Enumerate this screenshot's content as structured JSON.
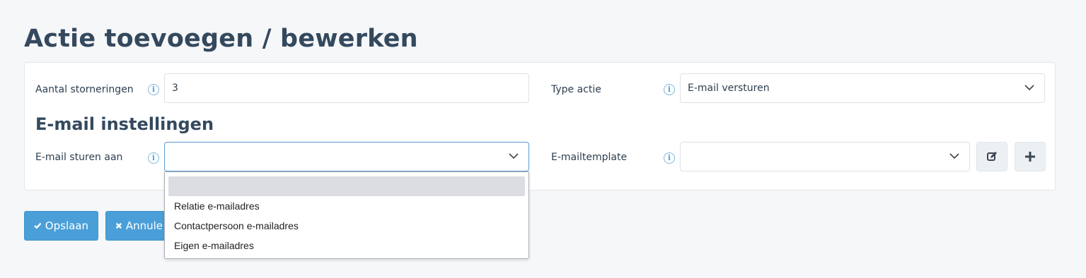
{
  "page": {
    "title": "Actie toevoegen / bewerken"
  },
  "form": {
    "aantal_storneringen": {
      "label": "Aantal storneringen",
      "value": "3"
    },
    "type_actie": {
      "label": "Type actie",
      "value": "E-mail versturen"
    },
    "section_title": "E-mail instellingen",
    "email_sturen_aan": {
      "label": "E-mail sturen aan",
      "value": ""
    },
    "emailtemplate": {
      "label": "E-mailtemplate",
      "value": ""
    }
  },
  "info_icon_glyph": "i",
  "dropdown": {
    "options": [
      "",
      "Relatie e-mailadres",
      "Contactpersoon e-mailadres",
      "Eigen e-mailadres"
    ],
    "highlighted_index": 0
  },
  "buttons": {
    "save": "Opslaan",
    "cancel": "Annule"
  },
  "colors": {
    "primary": "#4a9fd8",
    "title": "#34495e",
    "info": "#5aa6d6",
    "highlight": "#dcdde2"
  },
  "icons": {
    "edit": "edit-icon",
    "add": "plus-icon",
    "save": "check-icon",
    "cancel": "times-icon"
  }
}
